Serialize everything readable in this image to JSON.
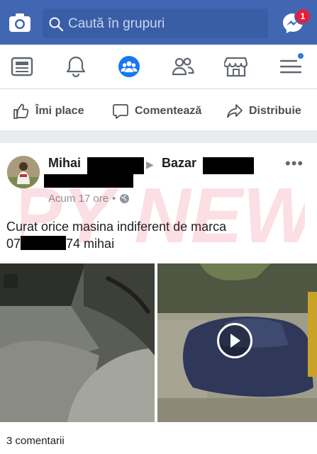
{
  "topbar": {
    "search_placeholder": "Caută în grupuri",
    "messenger_badge": "1"
  },
  "navbar": {
    "items": [
      {
        "icon": "news-feed-icon"
      },
      {
        "icon": "bell-icon"
      },
      {
        "icon": "groups-icon",
        "active": true
      },
      {
        "icon": "friends-icon"
      },
      {
        "icon": "marketplace-icon"
      },
      {
        "icon": "menu-icon"
      }
    ]
  },
  "actions": {
    "like": "Îmi place",
    "comment": "Comentează",
    "share": "Distribuie"
  },
  "post": {
    "author": "Mihai",
    "group": "Bazar",
    "time": "Acum 17 ore",
    "line1": "Curat orice masina indiferent de marca",
    "phone_prefix": "07",
    "phone_suffix": "74 mihai",
    "comments": "3 comentarii"
  },
  "watermark": "SPY NEWS",
  "colors": {
    "brand": "#4267b2",
    "badge": "#e41e3f",
    "active_icon": "#1877f2",
    "muted": "#90949c"
  }
}
